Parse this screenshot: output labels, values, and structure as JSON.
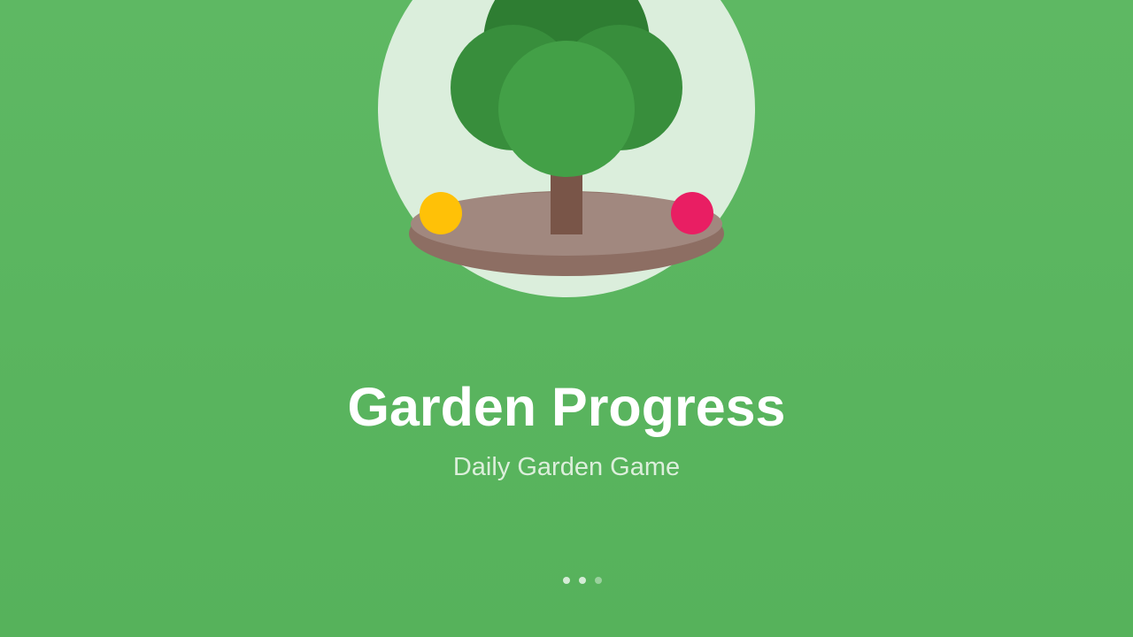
{
  "splash": {
    "title": "Garden Progress",
    "subtitle": "Daily Garden Game"
  },
  "illustration": {
    "icons": [
      "tree-icon",
      "soil-island-icon",
      "yellow-flower-icon",
      "pink-flower-icon"
    ]
  },
  "pager": {
    "count": 3,
    "active_index": 0
  },
  "colors": {
    "background": "#5cb660",
    "halo": "#dbeedc",
    "foliage_dark": "#2e7d32",
    "foliage_mid": "#388e3c",
    "foliage_front": "#43a047",
    "trunk": "#795548",
    "soil_top": "#a1887f",
    "soil_side": "#8d6e63",
    "flower_yellow": "#ffc107",
    "flower_pink": "#e91e63",
    "title_text": "#ffffff",
    "subtitle_text": "#dcefdb"
  }
}
